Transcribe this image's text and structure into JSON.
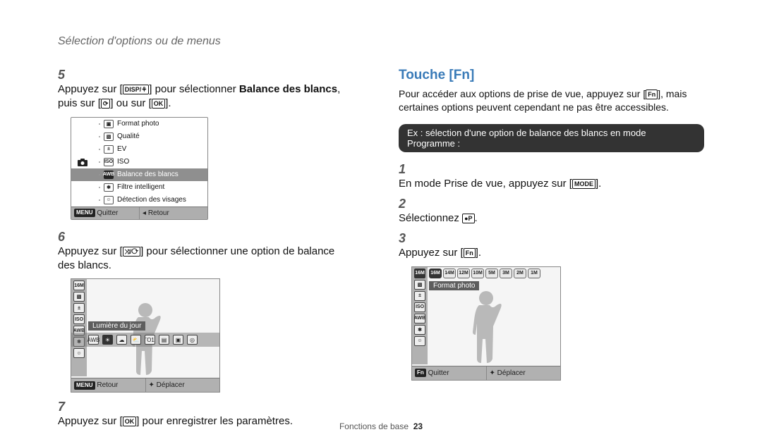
{
  "header": "Sélection d'options ou de menus",
  "left": {
    "step5": {
      "num": "5",
      "prefix": "Appuyez sur [",
      "btn1": "DISP/⚘",
      "mid1": "] pour sélectionner ",
      "bold": "Balance des blancs",
      "mid2": ", puis sur [",
      "btn2": "⟳",
      "mid3": "] ou sur [",
      "btn3": "OK",
      "suffix": "]."
    },
    "menu": {
      "rows": [
        {
          "icon": "▣",
          "label": "Format photo"
        },
        {
          "icon": "▧",
          "label": "Qualité"
        },
        {
          "icon": "±",
          "label": "EV"
        },
        {
          "icon": "ISO",
          "label": "ISO"
        },
        {
          "icon": "AWB",
          "label": "Balance des blancs"
        },
        {
          "icon": "✱",
          "label": "Filtre intelligent"
        },
        {
          "icon": "☺",
          "label": "Détection des visages"
        }
      ],
      "hiIndex": 4,
      "leftIcon": "●",
      "bottomLeftKey": "MENU",
      "bottomLeftLabel": "Quitter",
      "bottomRightKey": "◂",
      "bottomRightLabel": "Retour"
    },
    "step6": {
      "num": "6",
      "prefix": "Appuyez sur [",
      "btn": "⤨/⟳",
      "suffix": "] pour sélectionner une option de balance des blancs."
    },
    "live": {
      "sideIcons": [
        "16M",
        "▧",
        "±",
        "ISO",
        "AWB",
        "✱",
        "☺"
      ],
      "modeLabel": "Lumière du jour",
      "wbIcons": [
        "AWB",
        "☀",
        "☁",
        "⛅",
        "Ὂ1",
        "▤",
        "▣",
        "◎"
      ],
      "wbSel": 1,
      "bottomLeftKey": "MENU",
      "bottomLeftLabel": "Retour",
      "bottomRightKey": "✦",
      "bottomRightLabel": "Déplacer"
    },
    "step7": {
      "num": "7",
      "prefix": "Appuyez sur [",
      "btn": "OK",
      "suffix": "] pour enregistrer les paramètres."
    }
  },
  "right": {
    "title": "Touche [Fn]",
    "desc_prefix": "Pour accéder aux options de prise de vue, appuyez sur [",
    "desc_btn": "Fn",
    "desc_suffix": "], mais certaines options peuvent cependant ne pas être accessibles.",
    "blackbar": "Ex : sélection d'une option de balance des blancs en mode Programme :",
    "step1": {
      "num": "1",
      "prefix": "En mode Prise de vue, appuyez sur [",
      "btn": "MODE",
      "suffix": "]."
    },
    "step2": {
      "num": "2",
      "prefix": "Sélectionnez ",
      "btn": "●P",
      "suffix": "."
    },
    "step3": {
      "num": "3",
      "prefix": "Appuyez sur [",
      "btn": "Fn",
      "suffix": "]."
    },
    "live": {
      "sideIcons": [
        "16M",
        "▧",
        "±",
        "ISO",
        "AWB",
        "✱",
        "☺"
      ],
      "topChips": [
        "16M",
        "14M",
        "12M",
        "10M",
        "5M",
        "3M",
        "2M",
        "1M"
      ],
      "topSel": 0,
      "modeLabel": "Format photo",
      "bottomLeftKey": "Fn",
      "bottomLeftLabel": "Quitter",
      "bottomRightKey": "✦",
      "bottomRightLabel": "Déplacer"
    }
  },
  "footer": {
    "label": "Fonctions de base",
    "page": "23"
  }
}
